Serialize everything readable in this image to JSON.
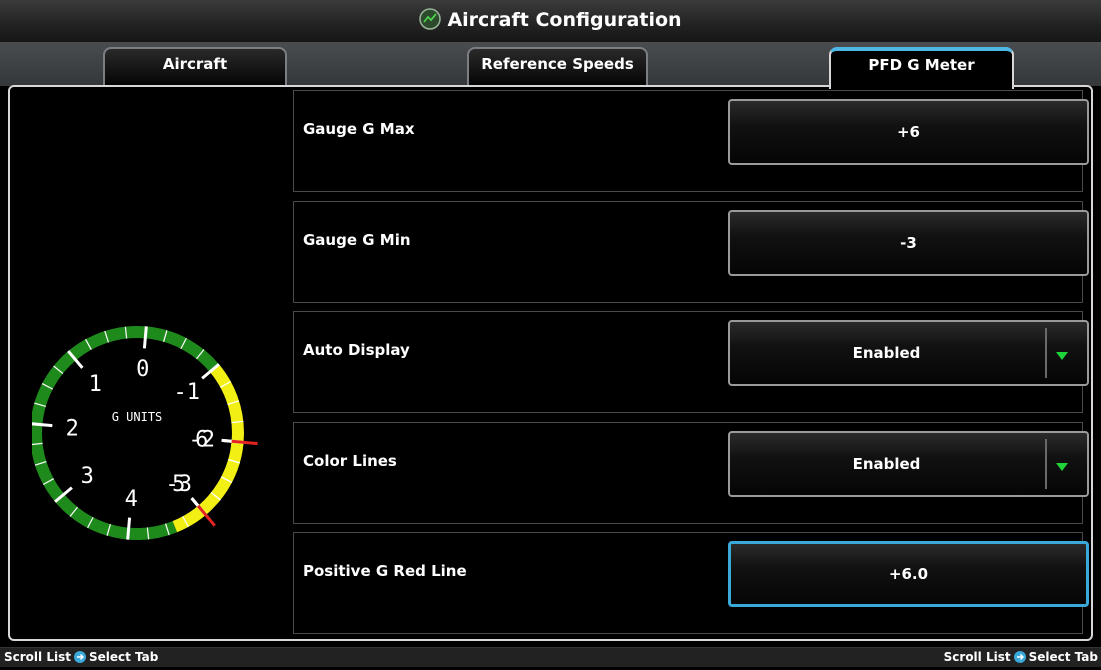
{
  "window": {
    "title": "Aircraft Configuration",
    "title_icon": "aircraft-config-icon"
  },
  "tabs": [
    {
      "label": "Aircraft",
      "active": false
    },
    {
      "label": "Reference Speeds",
      "active": false
    },
    {
      "label": "PFD G Meter",
      "active": true
    }
  ],
  "gauge": {
    "units_label": "G UNITS",
    "labels": [
      "-3",
      "-2",
      "-1",
      "0",
      "1",
      "2",
      "3",
      "4",
      "5",
      "6"
    ],
    "min": -3,
    "max": 6,
    "green_range": [
      -1,
      4.6
    ],
    "yellow_ranges": [
      [
        -2.8,
        -1
      ],
      [
        4.6,
        6
      ]
    ],
    "red_lines": [
      -3,
      6
    ],
    "colors": {
      "green": "#1f8a1c",
      "yellow": "#f2ef14",
      "red": "#e32222"
    }
  },
  "settings": [
    {
      "label": "Gauge G Max",
      "value": "+6",
      "type": "button"
    },
    {
      "label": "Gauge G Min",
      "value": "-3",
      "type": "button"
    },
    {
      "label": "Auto Display",
      "value": "Enabled",
      "type": "dropdown"
    },
    {
      "label": "Color Lines",
      "value": "Enabled",
      "type": "dropdown"
    },
    {
      "label": "Positive G Red Line",
      "value": "+6.0",
      "type": "button",
      "selected": true
    }
  ],
  "status": {
    "left_scroll": "Scroll List",
    "left_select": "Select Tab",
    "right_scroll": "Scroll List",
    "right_select": "Select Tab",
    "knob_icon": "knob-icon",
    "accent": "#3aa8d8"
  }
}
